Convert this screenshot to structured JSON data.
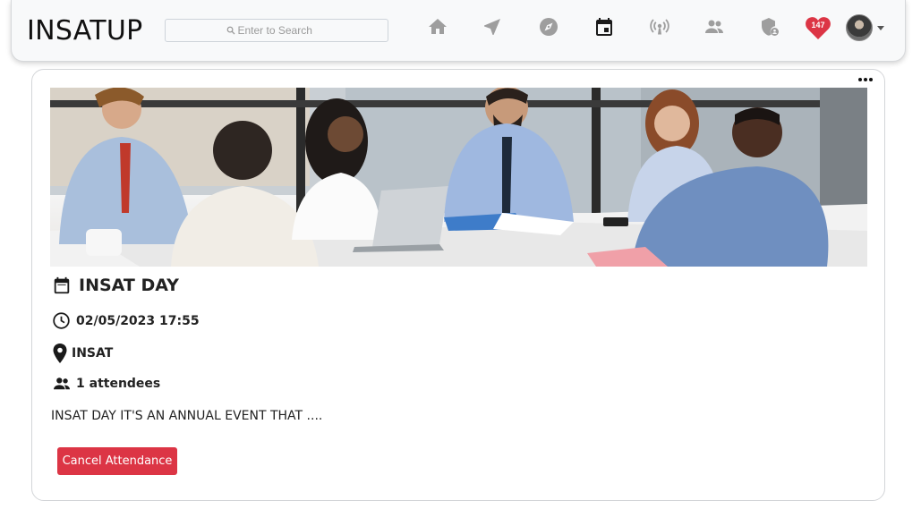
{
  "navbar": {
    "brand": "INSATUP",
    "search": {
      "placeholder": "Enter to Search",
      "value": ""
    },
    "icons": [
      "home-icon",
      "send-icon",
      "explore-icon",
      "calendar-icon",
      "broadcast-icon",
      "people-icon",
      "admin-shield-icon",
      "heart-icon",
      "avatar"
    ],
    "notification_count": "147",
    "colors": {
      "icon_inactive": "#9e9e9e",
      "icon_active": "#1a1a1a",
      "heart": "#dc3545"
    }
  },
  "event": {
    "title": "INSAT DAY",
    "datetime": "02/05/2023 17:55",
    "location": "INSAT",
    "attendees": "1 attendees",
    "description": "INSAT DAY IT'S AN ANNUAL EVENT THAT ....",
    "cancel_label": "Cancel Attendance",
    "image_alt": "business meeting photo",
    "colors": {
      "cancel_button": "#dc3545"
    }
  }
}
